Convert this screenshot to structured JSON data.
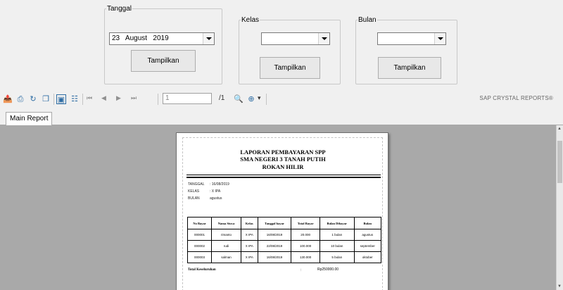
{
  "filters": {
    "tanggal": {
      "legend": "Tanggal",
      "day": "23",
      "month": "August",
      "year": "2019",
      "button": "Tampilkan"
    },
    "kelas": {
      "legend": "Kelas",
      "value": "",
      "button": "Tampilkan"
    },
    "bulan": {
      "legend": "Bulan",
      "value": "",
      "button": "Tampilkan"
    }
  },
  "toolbar": {
    "icons": [
      "export-icon",
      "print-icon",
      "refresh-icon",
      "copy-icon",
      "toggle-group-tree-icon",
      "group-tree-icon",
      "first-page-icon",
      "previous-page-icon",
      "next-page-icon",
      "last-page-icon",
      "find-icon",
      "zoom-icon"
    ],
    "page_input": "1",
    "page_total": "/1",
    "brand": "SAP CRYSTAL REPORTS®"
  },
  "tabs": [
    "Main Report"
  ],
  "report": {
    "title_line1": "LAPORAN PEMBAYARAN SPP",
    "title_line2": "SMA NEGERI 3 TANAH PUTIH",
    "title_line3": "ROKAN HILIR",
    "info": [
      {
        "label": "TANGGAL",
        "value": ": 16/08/2019"
      },
      {
        "label": "KELAS",
        "value": ": X IPA"
      },
      {
        "label": "BULAN",
        "value": "agustus"
      }
    ],
    "columns": [
      "No Bayar",
      "Nama Siswa",
      "Kelas",
      "Tanggal bayar",
      "Total Bayar",
      "Bulan Dibayar",
      "Bulan"
    ],
    "rows": [
      [
        "000001",
        "rimanto",
        "X IPA",
        "16/08/2019",
        "20.000",
        "1 bulan",
        "agustus"
      ],
      [
        "000002",
        "rudi",
        "X IPA",
        "22/08/2019",
        "100.000",
        "10 bulan",
        "september"
      ],
      [
        "000003",
        "salman",
        "X IPA",
        "16/08/2019",
        "130.000",
        "5 bulan",
        "oktober"
      ]
    ],
    "total_label": "Total Keseluruhan",
    "total_sep": ":",
    "total_value": "Rp250000.00"
  }
}
